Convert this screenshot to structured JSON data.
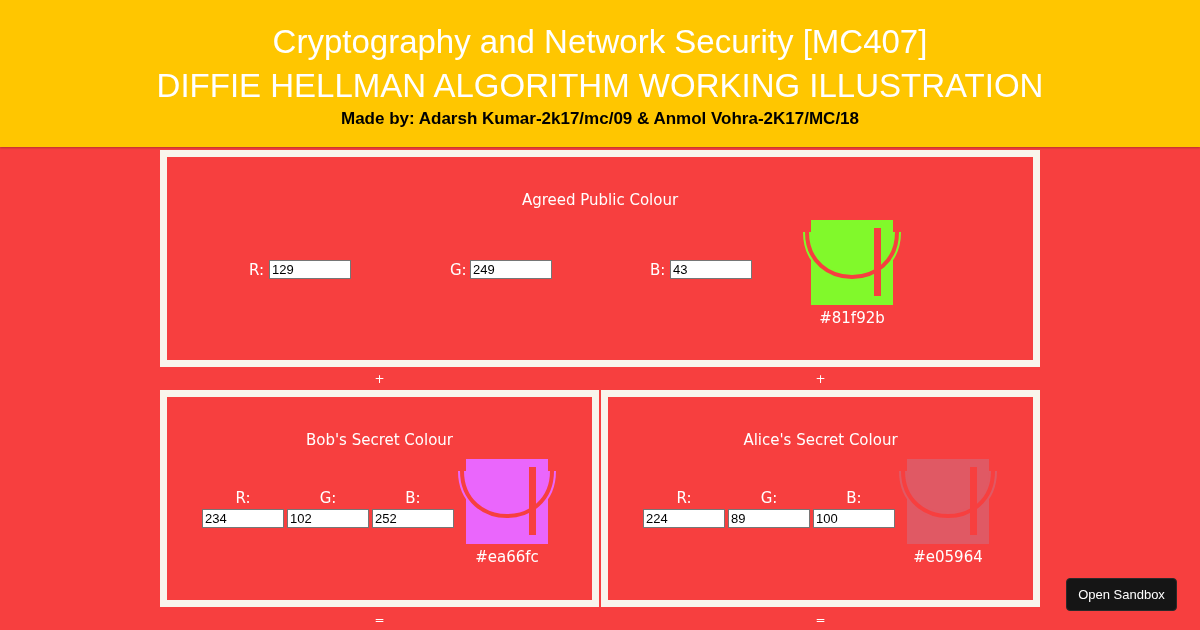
{
  "header": {
    "title": "Cryptography and Network Security [MC407]",
    "subtitle": "DIFFIE HELLMAN ALGORITHM WORKING ILLUSTRATION",
    "credits": "Made by: Adarsh Kumar-2k17/mc/09 & Anmol Vohra-2K17/MC/18"
  },
  "public_colour": {
    "title": "Agreed Public Colour",
    "fields": [
      {
        "label": "R:",
        "value": "129"
      },
      {
        "label": "G:",
        "value": "249"
      },
      {
        "label": "B:",
        "value": "43"
      }
    ],
    "color": "#81f92b",
    "hex": "#81f92b"
  },
  "plus_signs": [
    "+",
    "+"
  ],
  "secret_colours": [
    {
      "title": "Bob's Secret Colour",
      "fields": [
        {
          "label": "R:",
          "value": "234"
        },
        {
          "label": "G:",
          "value": "102"
        },
        {
          "label": "B:",
          "value": "252"
        }
      ],
      "color": "#ea66fc",
      "hex": "#ea66fc"
    },
    {
      "title": "Alice's Secret Colour",
      "fields": [
        {
          "label": "R:",
          "value": "224"
        },
        {
          "label": "G:",
          "value": "89"
        },
        {
          "label": "B:",
          "value": "100"
        }
      ],
      "color": "#e05964",
      "hex": "#e05964"
    }
  ],
  "equals_signs": [
    "=",
    "="
  ],
  "sandbox_button": "Open Sandbox"
}
